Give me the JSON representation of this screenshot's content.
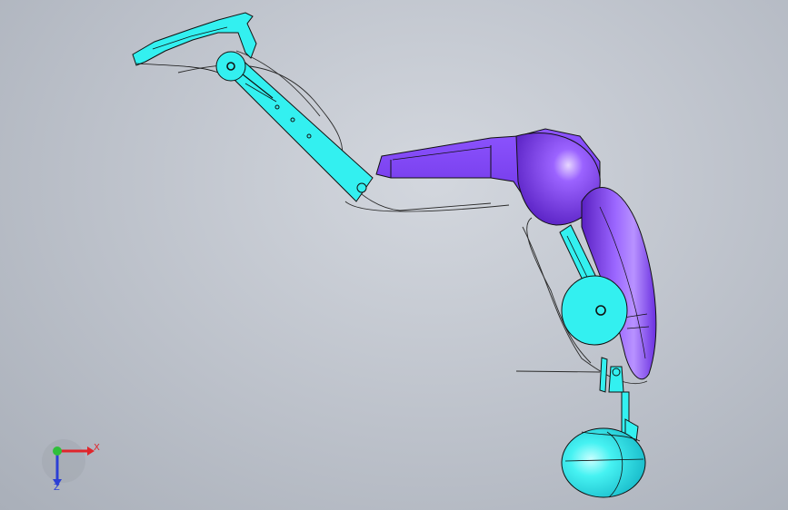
{
  "viewport": {
    "background": "#bcc1ca"
  },
  "colors": {
    "cyan_part": "#33f0f0",
    "cyan_dark": "#12b9c4",
    "purple_part": "#7a3cf0",
    "purple_dark": "#5b22c6",
    "purple_light": "#c9a8ff",
    "edge": "#111111",
    "axis_x": "#e0252b",
    "axis_y": "#2fbf3a",
    "axis_z": "#2b3fd6"
  },
  "triad": {
    "x_label": "X",
    "z_label": "Z"
  },
  "icons": {
    "triad": "coordinate-triad-icon"
  }
}
